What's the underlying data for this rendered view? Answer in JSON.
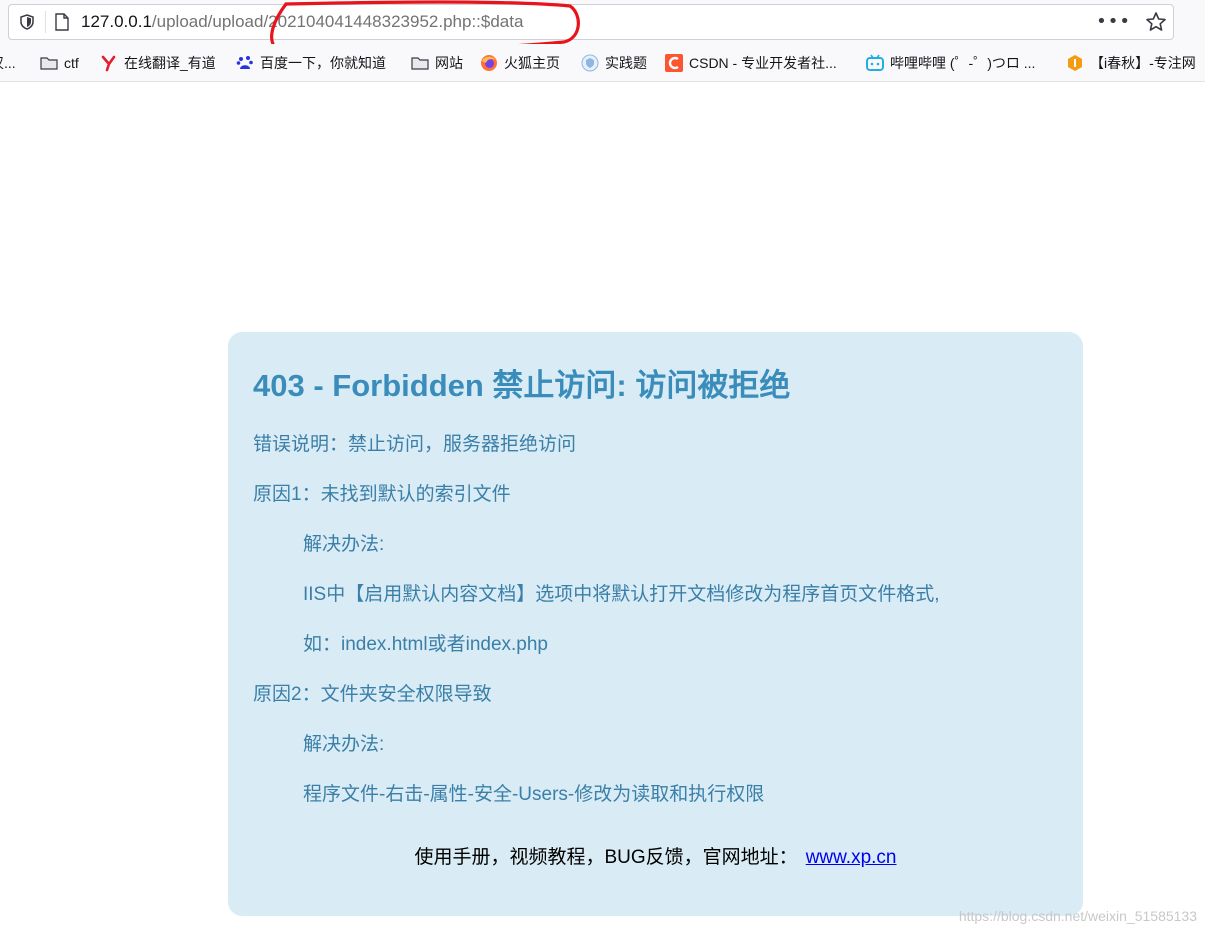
{
  "browser": {
    "url_host": "127.0.0.1",
    "url_path": "/upload/upload/202104041448323952.php::$data",
    "more_label": "•••"
  },
  "bookmarks": [
    {
      "label": "汉...",
      "icon": "truncated-icon"
    },
    {
      "label": "ctf",
      "icon": "folder-icon"
    },
    {
      "label": "在线翻译_有道",
      "icon": "youdao-icon"
    },
    {
      "label": "百度一下，你就知道",
      "icon": "baidu-icon"
    },
    {
      "label": "网站",
      "icon": "folder-icon"
    },
    {
      "label": "火狐主页",
      "icon": "firefox-icon"
    },
    {
      "label": "实践题",
      "icon": "shield-badge-icon"
    },
    {
      "label": "CSDN - 专业开发者社...",
      "icon": "csdn-icon"
    },
    {
      "label": "哔哩哔哩 (゜-゜)つロ ...",
      "icon": "bilibili-icon"
    },
    {
      "label": "【i春秋】-专注网",
      "icon": "ichunqiu-icon"
    }
  ],
  "error": {
    "title": "403 - Forbidden 禁止访问: 访问被拒绝",
    "description": "错误说明：禁止访问，服务器拒绝访问",
    "reason1": "原因1：未找到默认的索引文件",
    "solution1_label": "解决办法:",
    "solution1_text": "IIS中【启用默认内容文档】选项中将默认打开文档修改为程序首页文件格式,",
    "solution1_example": "如：index.html或者index.php",
    "reason2": "原因2：文件夹安全权限导致",
    "solution2_label": "解决办法:",
    "solution2_text": "程序文件-右击-属性-安全-Users-修改为读取和执行权限",
    "footer_text": "使用手册，视频教程，BUG反馈，官网地址：",
    "footer_link": "www.xp.cn"
  },
  "watermark": "https://blog.csdn.net/weixin_51585133",
  "colors": {
    "panel_bg": "#d9ecf5",
    "title": "#3a8dbb",
    "body_text": "#3b7fa8",
    "annotation": "#e8141b"
  }
}
